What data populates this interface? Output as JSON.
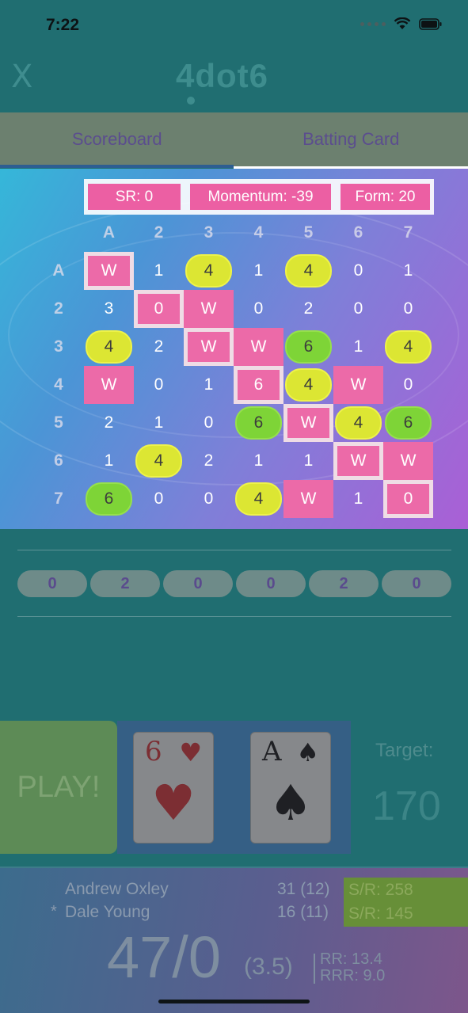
{
  "status_bar": {
    "time": "7:22"
  },
  "header": {
    "close_label": "X",
    "logo_text": "4dot6"
  },
  "tabs": [
    {
      "label": "Scoreboard"
    },
    {
      "label": "Batting Card"
    }
  ],
  "stats": {
    "sr": "SR: 0",
    "momentum": "Momentum: -39",
    "form": "Form: 20"
  },
  "grid": {
    "col_headers": [
      "A",
      "2",
      "3",
      "4",
      "5",
      "6",
      "7"
    ],
    "row_headers": [
      "A",
      "2",
      "3",
      "4",
      "5",
      "6",
      "7"
    ],
    "rows": [
      [
        "W",
        "1",
        "4",
        "1",
        "4",
        "0",
        "1"
      ],
      [
        "3",
        "0",
        "W",
        "0",
        "2",
        "0",
        "0"
      ],
      [
        "4",
        "2",
        "W",
        "W",
        "6",
        "1",
        "4"
      ],
      [
        "W",
        "0",
        "1",
        "6",
        "4",
        "W",
        "0"
      ],
      [
        "2",
        "1",
        "0",
        "6",
        "W",
        "4",
        "6"
      ],
      [
        "1",
        "4",
        "2",
        "1",
        "1",
        "W",
        "W"
      ],
      [
        "6",
        "0",
        "0",
        "4",
        "W",
        "1",
        "0"
      ]
    ]
  },
  "over_pills": [
    "0",
    "2",
    "0",
    "0",
    "2",
    "0"
  ],
  "play": {
    "label": "PLAY!"
  },
  "cards": [
    {
      "rank": "6",
      "suit": "♥",
      "color": "red"
    },
    {
      "rank": "A",
      "suit": "♠",
      "color": "black"
    }
  ],
  "target": {
    "label": "Target:",
    "value": "170"
  },
  "batsmen": [
    {
      "name": "Andrew Oxley",
      "score": "31 (12)",
      "sr": "S/R: 258"
    },
    {
      "name": "Dale Young",
      "score": "16 (11)",
      "sr": "S/R: 145"
    }
  ],
  "strike_marker": "*",
  "innings": {
    "total": "47/0",
    "overs": "(3.5)",
    "rr": "RR: 13.4",
    "rrr": "RRR: 9.0"
  },
  "colors": {
    "pink": "#ec6aa8",
    "yellow": "#dce633",
    "green": "#7ed437",
    "teal_bg": "#206e71"
  }
}
